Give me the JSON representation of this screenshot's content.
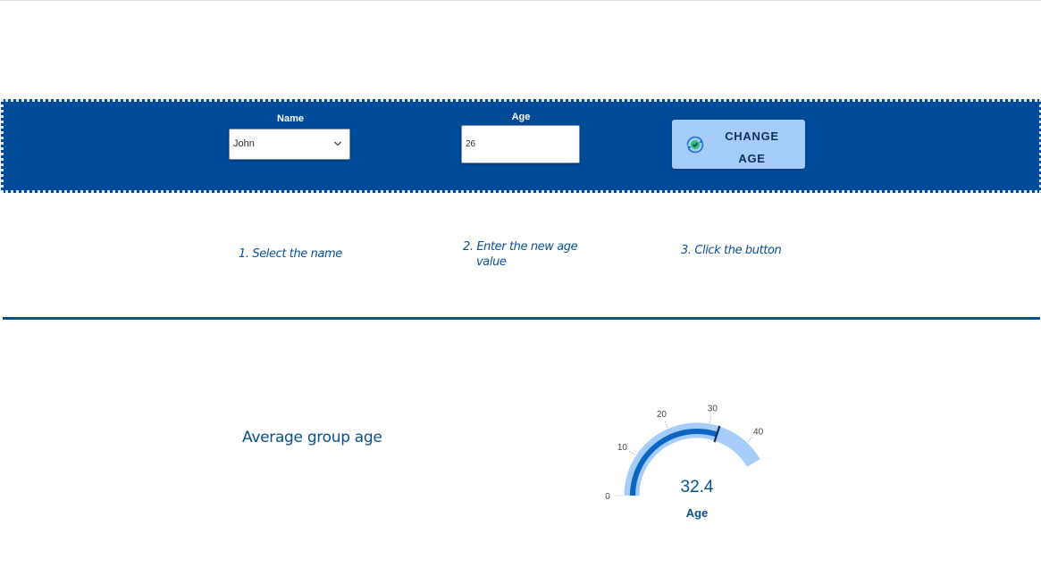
{
  "form": {
    "name_label": "Name",
    "name_selected": "John",
    "age_label": "Age",
    "age_value": "26",
    "button_line1": "CHANGE",
    "button_line2": "AGE",
    "colors": {
      "band": "#004b99",
      "button": "#a6cdfa"
    }
  },
  "steps": {
    "step1": "1. Select the name",
    "step2_line1": "2. Enter the new age",
    "step2_line2": "value",
    "step3": "3. Click the button"
  },
  "summary": {
    "title": "Average group age"
  },
  "gauge": {
    "value": 32.4,
    "value_text": "32.4",
    "label": "Age",
    "min": 0,
    "max": 45,
    "ticks": [
      "0",
      "10",
      "20",
      "30",
      "40"
    ],
    "colors": {
      "track": "#a6cdfa",
      "fill": "#0a66c2",
      "text": "#0a4f8f"
    }
  }
}
